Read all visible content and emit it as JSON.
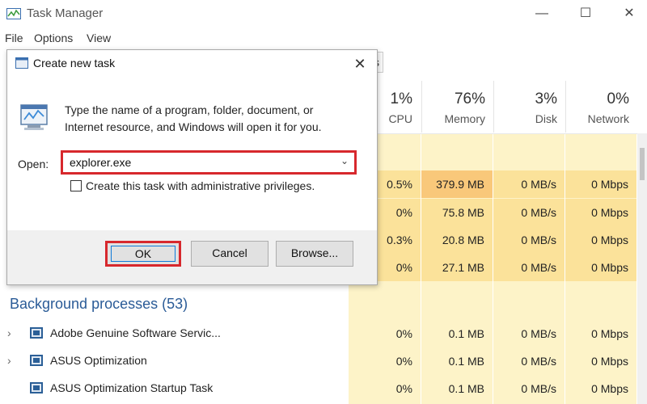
{
  "window": {
    "title": "Task Manager",
    "controls": {
      "minimize": "—",
      "maximize": "☐",
      "close": "✕"
    }
  },
  "menu": {
    "items": [
      "File",
      "Options",
      "View"
    ]
  },
  "tab_fragment": "s",
  "columns": [
    {
      "percent": "1%",
      "name": "CPU"
    },
    {
      "percent": "76%",
      "name": "Memory"
    },
    {
      "percent": "3%",
      "name": "Disk"
    },
    {
      "percent": "0%",
      "name": "Network"
    }
  ],
  "app_rows": [
    {
      "cpu": "0.5%",
      "memory": "379.9 MB",
      "disk": "0 MB/s",
      "network": "0 Mbps"
    },
    {
      "cpu": "0%",
      "memory": "75.8 MB",
      "disk": "0 MB/s",
      "network": "0 Mbps"
    },
    {
      "cpu": "0.3%",
      "memory": "20.8 MB",
      "disk": "0 MB/s",
      "network": "0 Mbps"
    },
    {
      "cpu": "0%",
      "memory": "27.1 MB",
      "disk": "0 MB/s",
      "network": "0 Mbps"
    }
  ],
  "background": {
    "title": "Background processes (53)",
    "rows": [
      {
        "name": "Adobe Genuine Software Servic...",
        "cpu": "0%",
        "memory": "0.1 MB",
        "disk": "0 MB/s",
        "network": "0 Mbps",
        "expandable": true
      },
      {
        "name": "ASUS Optimization",
        "cpu": "0%",
        "memory": "0.1 MB",
        "disk": "0 MB/s",
        "network": "0 Mbps",
        "expandable": true
      },
      {
        "name": "ASUS Optimization Startup Task",
        "cpu": "0%",
        "memory": "0.1 MB",
        "disk": "0 MB/s",
        "network": "0 Mbps",
        "expandable": false
      }
    ]
  },
  "dialog": {
    "title": "Create new task",
    "close": "✕",
    "prompt": "Type the name of a program, folder, document, or Internet resource, and Windows will open it for you.",
    "open_label": "Open:",
    "open_value": "explorer.exe",
    "caret": "⌄",
    "admin_checkbox_label": "Create this task with administrative privileges.",
    "admin_checked": false,
    "buttons": {
      "ok": "OK",
      "cancel": "Cancel",
      "browse": "Browse..."
    }
  },
  "colors": {
    "highlight_border": "#d7282d",
    "section_title": "#2a5b97",
    "cell_light": "#fdf3c8",
    "cell_medium": "#fbe29a",
    "cell_strong": "#f9d387"
  }
}
